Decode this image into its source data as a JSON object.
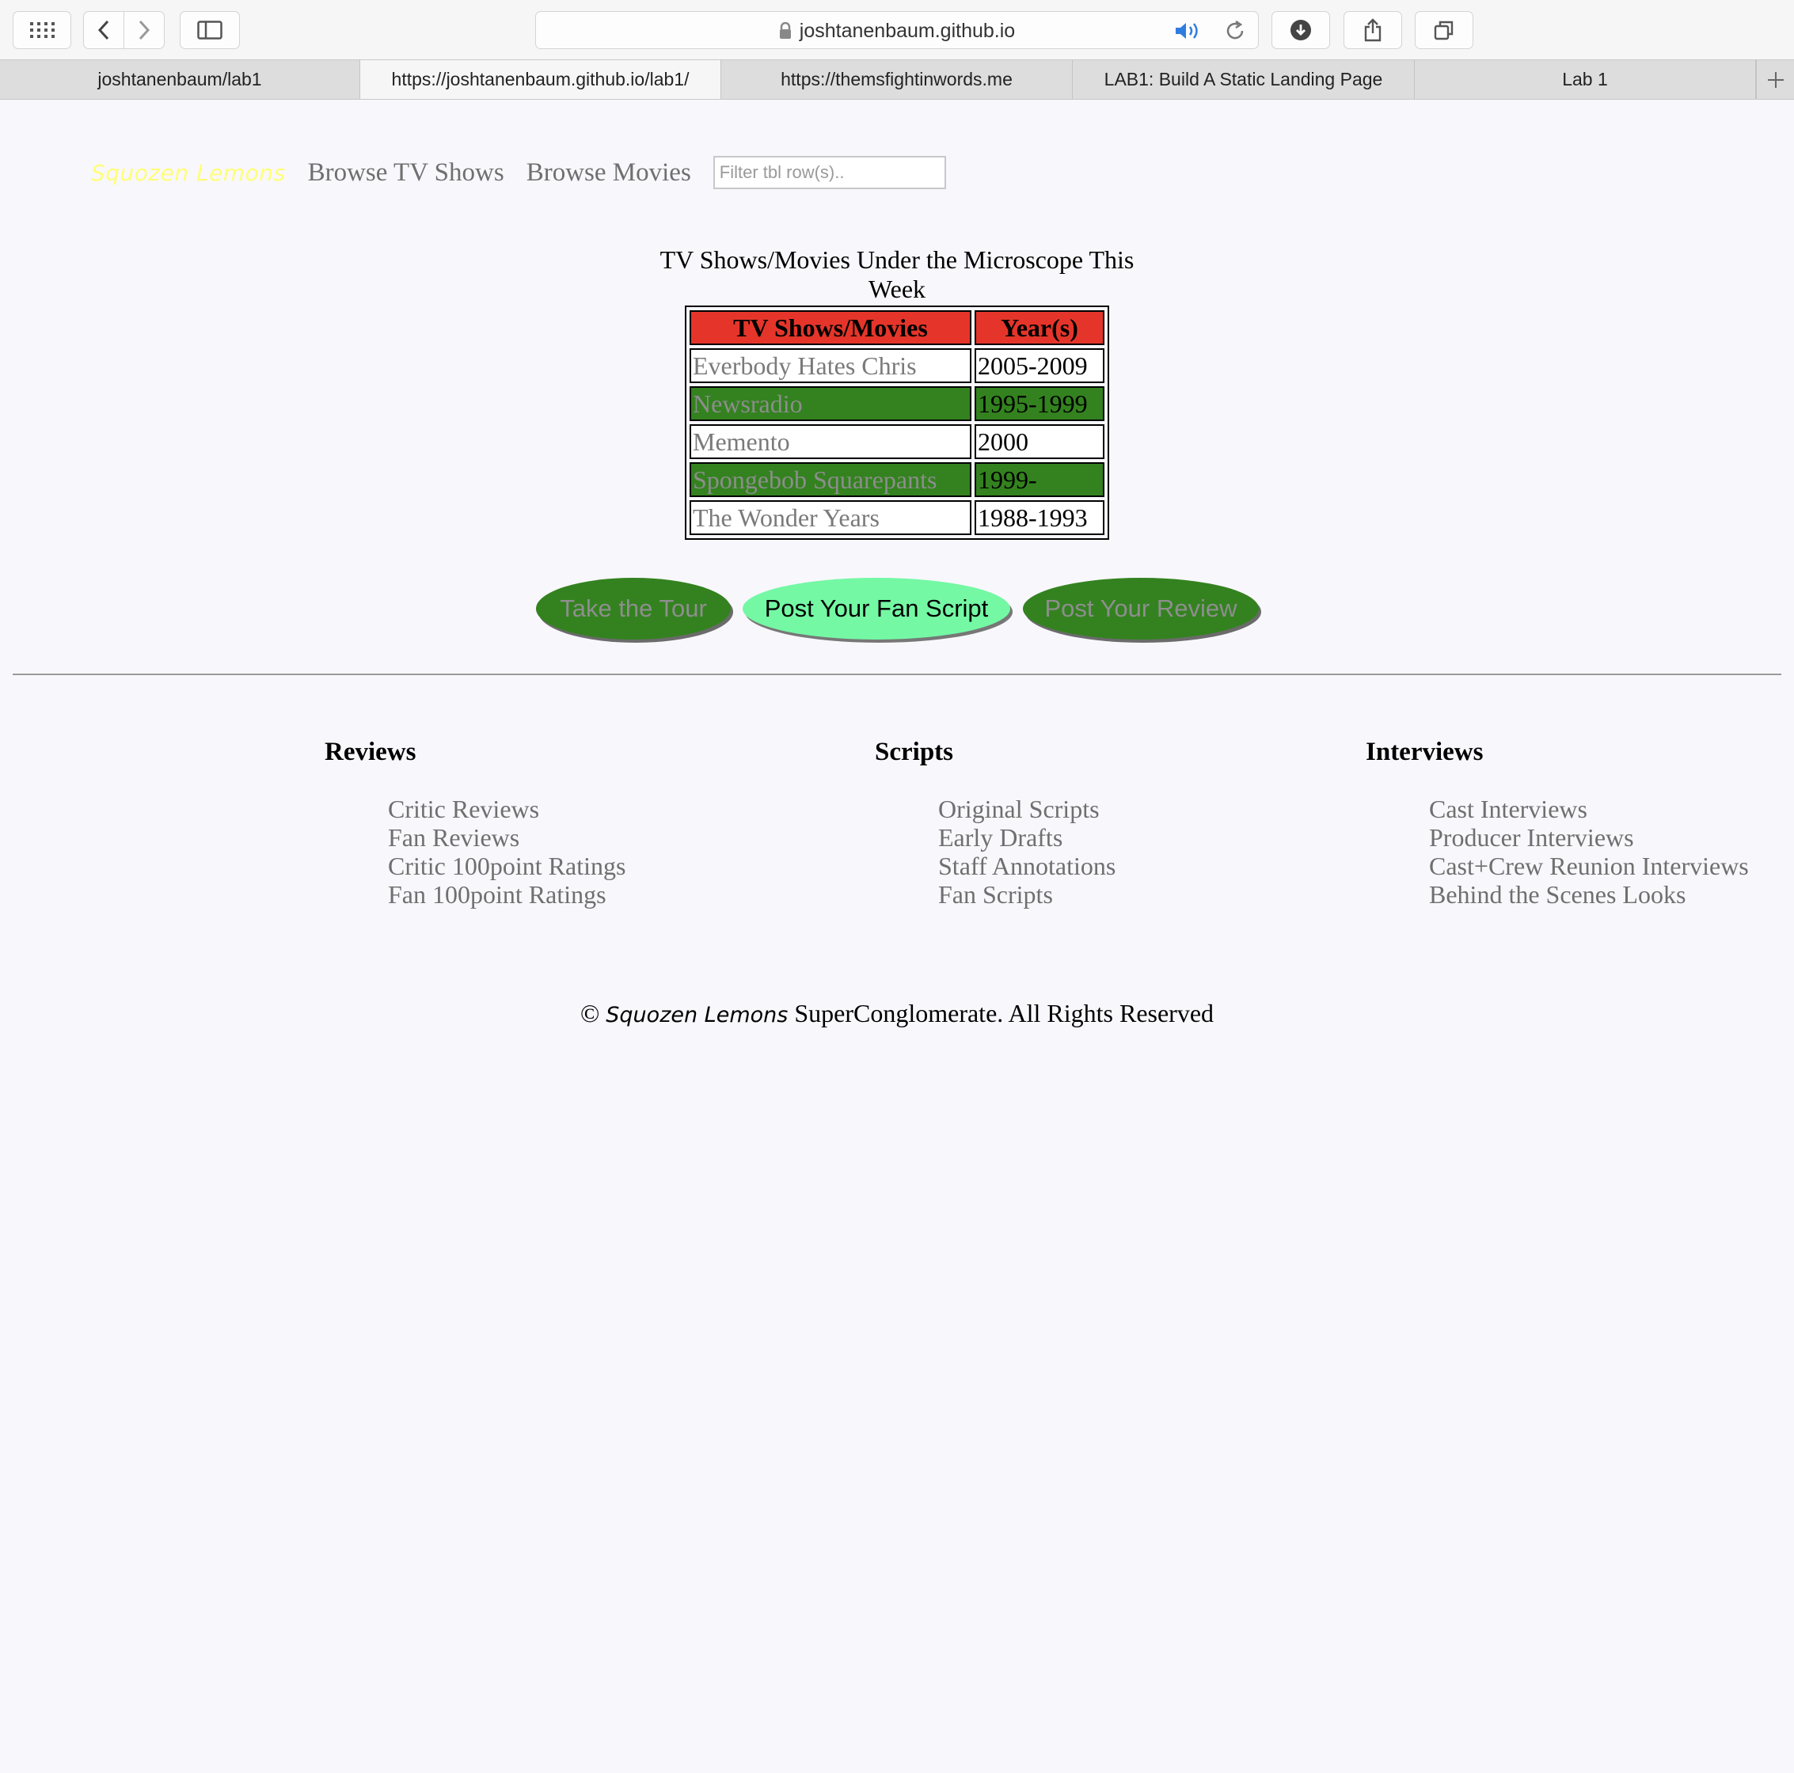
{
  "browser": {
    "url": "joshtanenbaum.github.io",
    "tabs": [
      {
        "label": "joshtanenbaum/lab1"
      },
      {
        "label": "https://joshtanenbaum.github.io/lab1/"
      },
      {
        "label": "https://themsfightinwords.me"
      },
      {
        "label": "LAB1: Build A Static Landing Page"
      },
      {
        "label": "Lab 1"
      }
    ]
  },
  "nav": {
    "brand": "Squozen Lemons",
    "links": [
      "Browse TV Shows",
      "Browse Movies"
    ],
    "filter_placeholder": "Filter tbl row(s).."
  },
  "table": {
    "caption": "TV Shows/Movies Under the Microscope This Week",
    "headers": [
      "TV Shows/Movies",
      "Year(s)"
    ],
    "rows": [
      {
        "title": "Everbody Hates Chris",
        "years": "2005-2009"
      },
      {
        "title": "Newsradio",
        "years": "1995-1999"
      },
      {
        "title": "Memento",
        "years": "2000"
      },
      {
        "title": "Spongebob Squarepants",
        "years": "1999-"
      },
      {
        "title": "The Wonder Years",
        "years": "1988-1993"
      }
    ]
  },
  "buttons": [
    "Take the Tour",
    "Post Your Fan Script",
    "Post Your Review"
  ],
  "footer": {
    "columns": [
      {
        "heading": "Reviews",
        "links": [
          "Critic Reviews",
          "Fan Reviews",
          "Critic 100point Ratings",
          "Fan 100point Ratings"
        ]
      },
      {
        "heading": "Scripts",
        "links": [
          "Original Scripts",
          "Early Drafts",
          "Staff Annotations",
          "Fan Scripts"
        ]
      },
      {
        "heading": "Interviews",
        "links": [
          "Cast Interviews",
          "Producer Interviews",
          "Cast+Crew Reunion Interviews",
          "Behind the Scenes Looks"
        ]
      }
    ],
    "copyright_symbol": "©",
    "copyright_brand": "Squozen Lemons",
    "copyright_rest": "SuperConglomerate. All Rights Reserved"
  },
  "colors": {
    "brand": "#ffff77",
    "header_red": "#e5352a",
    "row_green": "#33821f",
    "button_light": "#74f8a4"
  },
  "icons": [
    "apps-grid-icon",
    "back-icon",
    "forward-icon",
    "sidebar-icon",
    "lock-icon",
    "speaker-icon",
    "reload-icon",
    "download-icon",
    "share-icon",
    "tabs-overview-icon",
    "new-tab-plus-icon"
  ]
}
